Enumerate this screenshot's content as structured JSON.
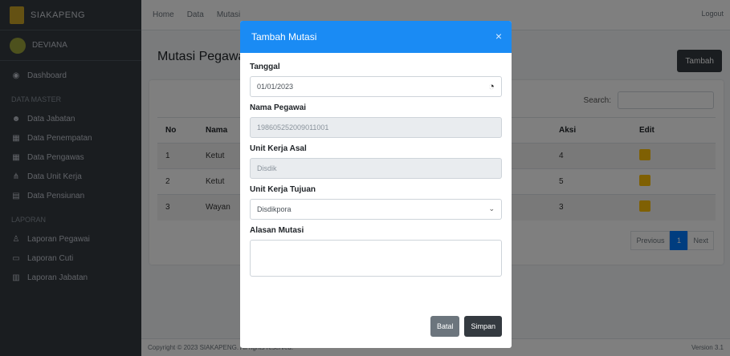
{
  "app": {
    "brand": "SIAKAPENG",
    "user": "DEVIANA"
  },
  "sidebar": {
    "items": [
      {
        "label": "Dashboard",
        "icon": "dashboard-icon"
      },
      {
        "header": "DATA MASTER"
      },
      {
        "label": "Data Jabatan",
        "icon": "users-icon"
      },
      {
        "label": "Data Penempatan",
        "icon": "building-icon"
      },
      {
        "label": "Data Pengawas",
        "icon": "building-icon"
      },
      {
        "label": "Data Unit Kerja",
        "icon": "sitemap-icon"
      },
      {
        "label": "Data Pensiunan",
        "icon": "id-card-icon"
      },
      {
        "header": "LAPORAN"
      },
      {
        "label": "Laporan Pegawai",
        "icon": "user-icon"
      },
      {
        "label": "Laporan Cuti",
        "icon": "file-icon"
      },
      {
        "label": "Laporan Jabatan",
        "icon": "table-icon"
      }
    ]
  },
  "topbar": {
    "links": [
      "Home",
      "Data",
      "Mutasi"
    ],
    "right": "Logout"
  },
  "content": {
    "title": "Mutasi Pegawai",
    "add_label": "Tambah",
    "search_label": "Search:",
    "columns": [
      "No",
      "Nama",
      "",
      "",
      "",
      "Aksi",
      "Edit"
    ],
    "rows": [
      {
        "no": "1",
        "nama": "Ketut",
        "aksi": "4"
      },
      {
        "no": "2",
        "nama": "Ketut",
        "aksi": "5"
      },
      {
        "no": "3",
        "nama": "Wayan",
        "aksi": "3"
      }
    ],
    "pagination": {
      "previous": "Previous",
      "current": "1",
      "next": "Next"
    }
  },
  "footer": {
    "left": "Copyright © 2023 SIAKAPENG. All rights reserved.",
    "right": "Version 3.1"
  },
  "modal": {
    "title": "Tambah Mutasi",
    "close": "×",
    "fields": [
      {
        "label": "Tanggal",
        "value": "01/01/2023",
        "type": "date"
      },
      {
        "label": "Nama Pegawai",
        "value": "198605252009011001",
        "type": "readonly"
      },
      {
        "label": "Unit Kerja Asal",
        "value": "Disdik",
        "type": "readonly"
      },
      {
        "label": "Unit Kerja Tujuan",
        "value": "Disdikpora",
        "type": "select"
      },
      {
        "label": "Alasan Mutasi",
        "value": "",
        "type": "textarea"
      }
    ],
    "cancel_label": "Batal",
    "save_label": "Simpan"
  }
}
